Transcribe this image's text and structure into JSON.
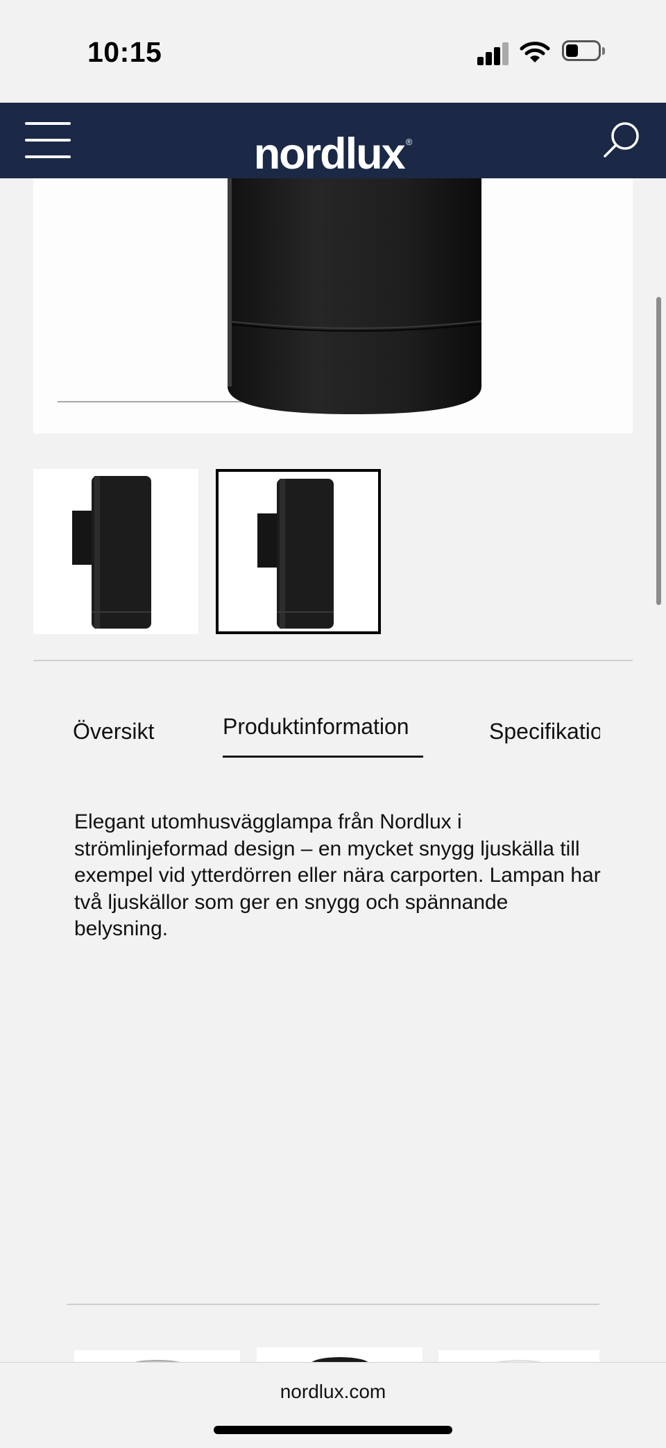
{
  "status_bar": {
    "time": "10:15"
  },
  "header": {
    "logo": "nordlux",
    "logo_mark": "®"
  },
  "icons": {
    "menu": "hamburger-menu-icon",
    "search": "search-icon",
    "signal": "cellular-signal-icon",
    "wifi": "wifi-icon",
    "battery": "battery-icon"
  },
  "gallery": {
    "thumbnails": [
      {
        "selected": false
      },
      {
        "selected": true
      }
    ]
  },
  "tabs": [
    {
      "label": "Översikt",
      "active": false
    },
    {
      "label": "Produktinformation",
      "active": true
    },
    {
      "label": "Specifikatio",
      "active": false
    }
  ],
  "description": "Elegant utomhusvägglampa från Nordlux i strömlinjeformad design – en mycket snygg ljuskälla till exempel vid ytterdörren eller nära carporten. Lampan har två ljuskällor som ger en snygg och spännande belysning.",
  "browser": {
    "url": "nordlux.com"
  },
  "colors": {
    "header_bg": "#1b2947",
    "page_bg": "#f2f2f2",
    "product": "#1a1a1a"
  }
}
